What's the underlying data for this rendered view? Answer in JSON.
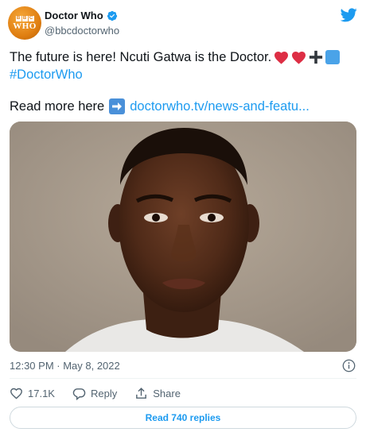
{
  "account": {
    "display_name": "Doctor Who",
    "handle": "@bbcdoctorwho",
    "verified": true,
    "avatar_text": "WHO",
    "avatar_brand": "BBC"
  },
  "tweet": {
    "text": "The future is here! Ncuti Gatwa is the Doctor.",
    "emojis": [
      "heart-icon",
      "heart-icon",
      "plus-icon",
      "square-icon"
    ],
    "hashtag": "#DoctorWho",
    "read_more_label": "Read more here",
    "link_text": "doctorwho.tv/news-and-featu...",
    "timestamp": "12:30 PM · May 8, 2022"
  },
  "actions": {
    "like_count": "17.1K",
    "reply_label": "Reply",
    "share_label": "Share"
  },
  "replies_button": {
    "label": "Read 740 replies"
  },
  "colors": {
    "accent": "#1d9bf0",
    "text": "#0f1419",
    "muted": "#536471",
    "heart": "#e0245e",
    "avatar": "#e07f12"
  }
}
